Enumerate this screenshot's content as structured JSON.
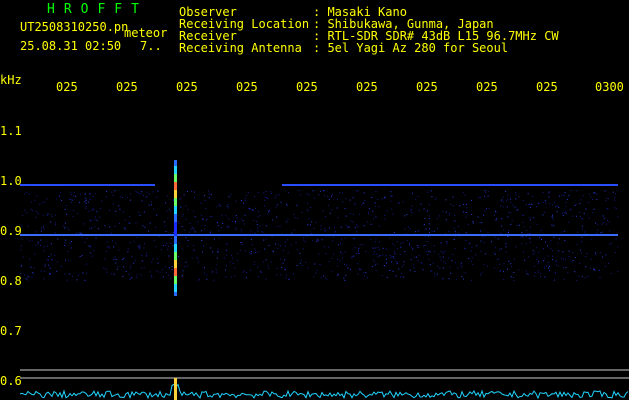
{
  "header": {
    "brand": "HROFFT",
    "file_name": "UT2508310250.pn",
    "tag": "meteor",
    "datetime": "25.08.31 02:50",
    "count": "7..",
    "labels": {
      "observer": "Observer",
      "location": "Receiving Location",
      "receiver": "Receiver",
      "antenna": "Receiving Antenna"
    },
    "values": {
      "observer": ": Masaki Kano",
      "location": ": Shibukawa, Gunma, Japan",
      "receiver": ": RTL-SDR SDR# 43dB L15 96.7MHz CW",
      "antenna": ": 5el Yagi Az 280 for Seoul"
    }
  },
  "axis": {
    "unit": "kHz",
    "time_ticks": [
      "025",
      "025",
      "025",
      "025",
      "025",
      "025",
      "025",
      "025",
      "025",
      "0300"
    ],
    "freq_ticks": [
      "1.1",
      "1.0",
      "0.9",
      "0.8",
      "0.7",
      "0.6"
    ]
  },
  "colors": {
    "background": "#000000",
    "text": "#ffff00",
    "brand": "#00ff00",
    "noise": "#1a2bd6",
    "carrier": "#3a6bff",
    "spectrum": "#22d4ff"
  }
}
